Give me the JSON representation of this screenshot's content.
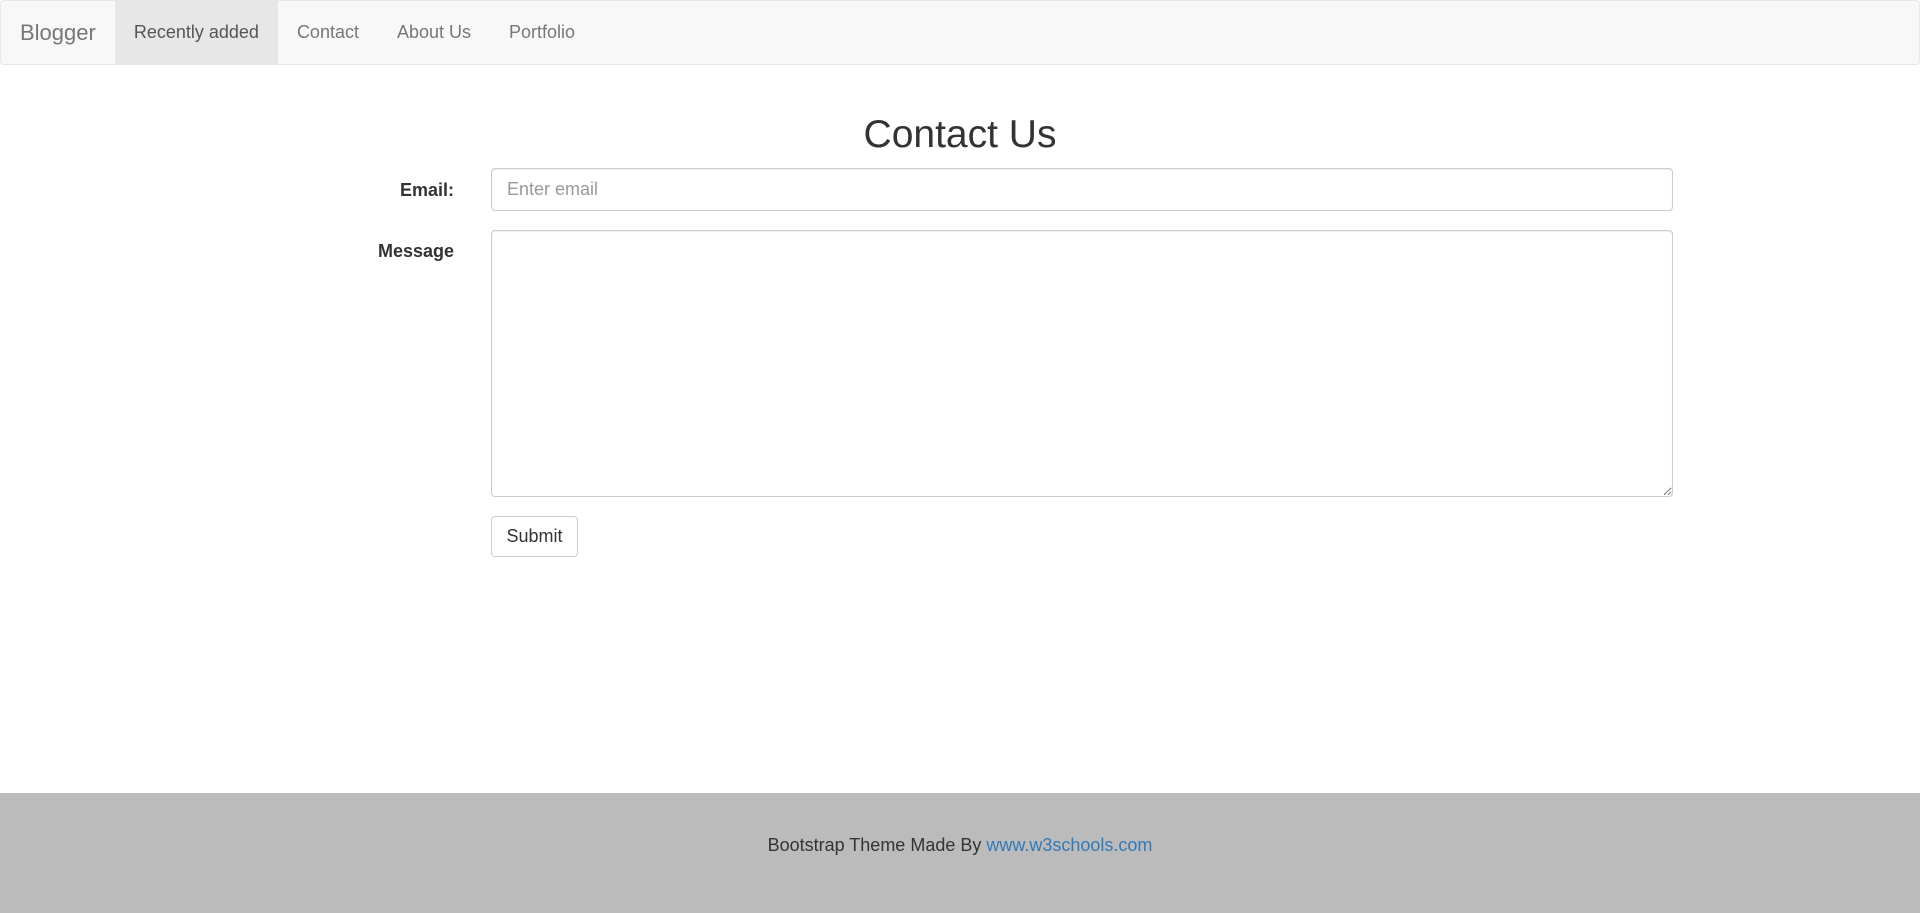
{
  "navbar": {
    "brand": "Blogger",
    "items": [
      {
        "label": "Recently added",
        "active": true
      },
      {
        "label": "Contact",
        "active": false
      },
      {
        "label": "About Us",
        "active": false
      },
      {
        "label": "Portfolio",
        "active": false
      }
    ]
  },
  "main": {
    "title": "Contact Us",
    "email_label": "Email:",
    "email_placeholder": "Enter email",
    "email_value": "",
    "message_label": "Message",
    "message_value": "",
    "submit_label": "Submit"
  },
  "footer": {
    "text": "Bootstrap Theme Made By ",
    "link_text": "www.w3schools.com"
  },
  "colors": {
    "navbar_bg": "#f8f8f8",
    "active_item_bg": "#e7e7e7",
    "footer_bg": "#bbbbbb",
    "link": "#337ab7"
  }
}
